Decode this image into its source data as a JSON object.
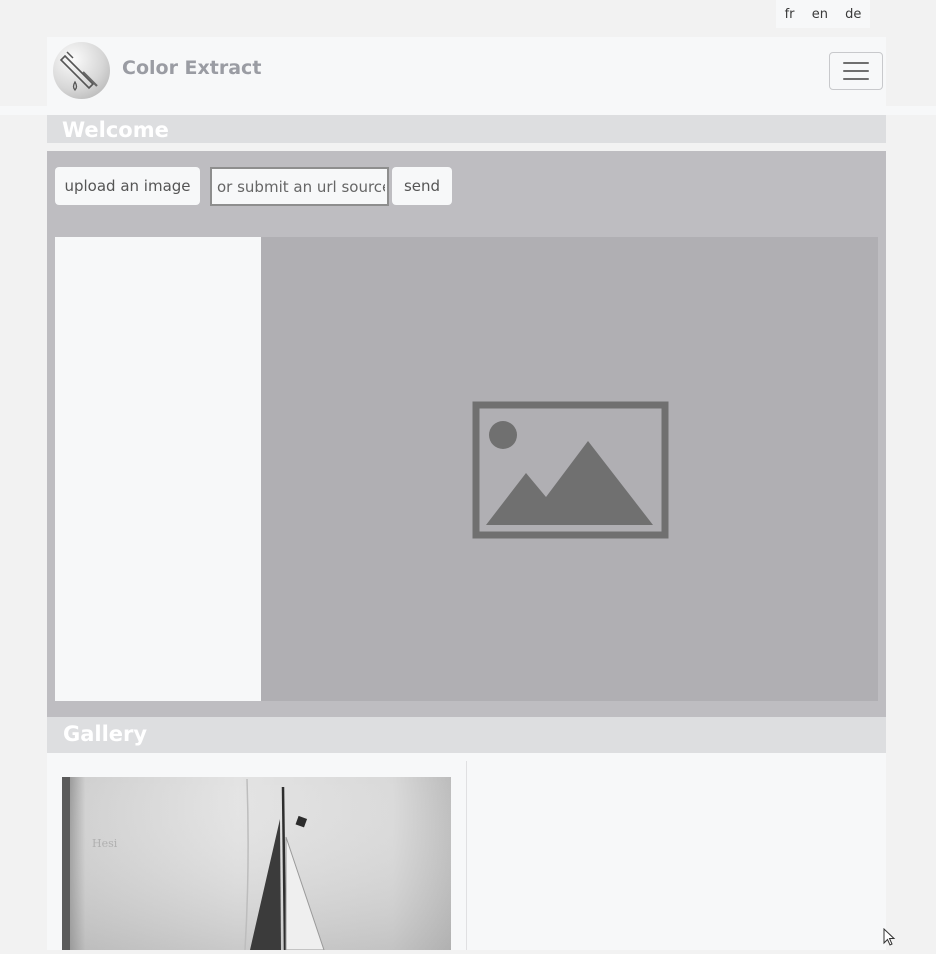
{
  "languages": [
    "fr",
    "en",
    "de"
  ],
  "navbar": {
    "brand": "Color Extract",
    "menu_icon": "hamburger-icon",
    "logo_icon": "eyedropper-logo"
  },
  "welcome": {
    "title": "Welcome"
  },
  "controls": {
    "upload_label": "upload an image",
    "url_placeholder": "or submit an url source",
    "url_value": "",
    "send_label": "send"
  },
  "preview": {
    "placeholder_icon": "image-placeholder-icon"
  },
  "gallery": {
    "title": "Gallery",
    "items": [
      {
        "thumbnail": "sailboat-photo"
      }
    ]
  },
  "colors": {
    "page_bg": "#f2f2f2",
    "panel_bg": "#bebdc1",
    "preview_bg": "#b0afb3",
    "header_bg": "#dddee0",
    "light": "#f7f8f9",
    "brand_text": "#9a9ca3",
    "icon_gray": "#707070"
  }
}
